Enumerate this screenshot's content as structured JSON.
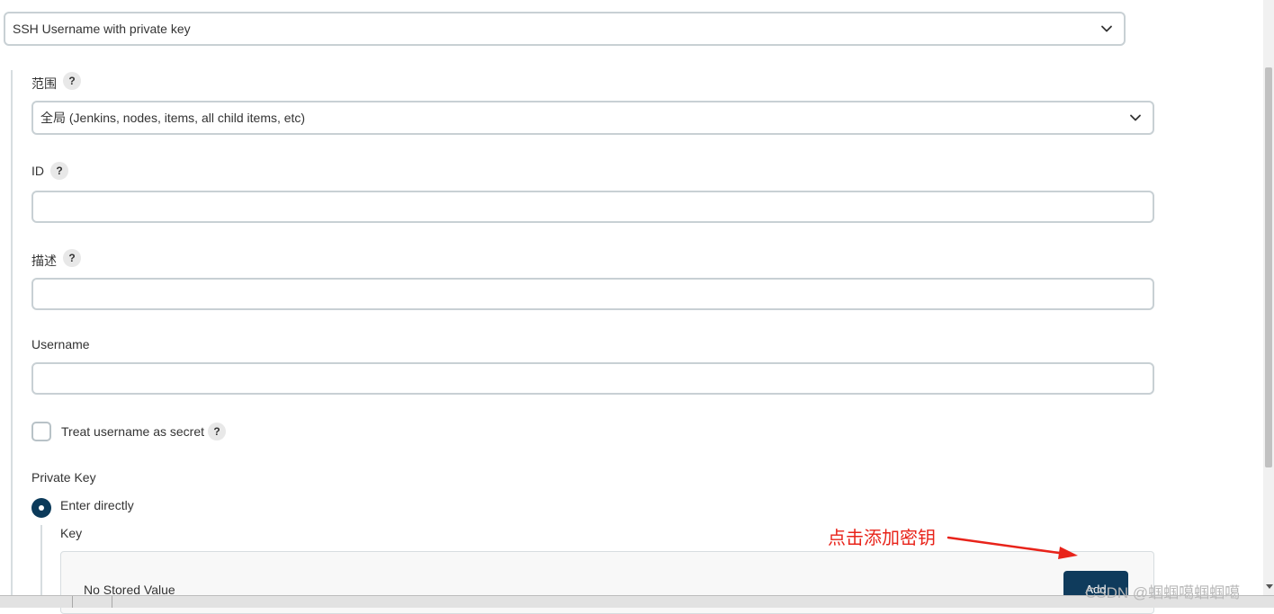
{
  "kind_select": {
    "value": "SSH Username with private key",
    "icon": "chevron-down-icon"
  },
  "scope": {
    "label": "范围",
    "help": "?",
    "value": "全局 (Jenkins, nodes, items, all child items, etc)",
    "icon": "chevron-down-icon"
  },
  "id_field": {
    "label": "ID",
    "help": "?",
    "value": ""
  },
  "description_field": {
    "label": "描述",
    "help": "?",
    "value": ""
  },
  "username_field": {
    "label": "Username",
    "value": ""
  },
  "treat_secret": {
    "label": "Treat username as secret",
    "help": "?",
    "checked": false
  },
  "private_key": {
    "label": "Private Key",
    "option": "Enter directly",
    "selected": true,
    "key_label": "Key",
    "stored_value": "No Stored Value",
    "add_button": "Add"
  },
  "annotation": {
    "text": "点击添加密钥",
    "color": "#e8231a"
  },
  "watermark": "CSDN @蝈蝈噶蝈蝈噶",
  "colors": {
    "accent": "#0f3b5c",
    "border": "#c8d0d4"
  }
}
